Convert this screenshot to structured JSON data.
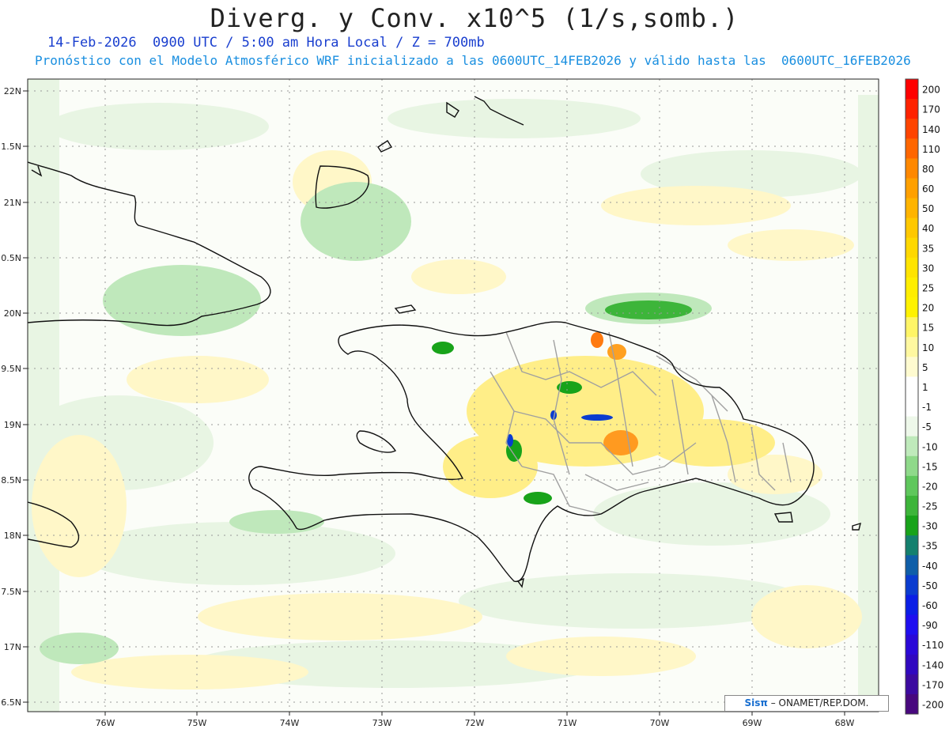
{
  "title": "Diverg. y Conv. x10^5 (1/s,somb.)",
  "subtitle_line1": "14-Feb-2026  0900 UTC / 5:00 am Hora Local / Z = 700mb",
  "subtitle_line2": "Pronóstico con el Modelo Atmosférico WRF inicializado a las 0600UTC_14FEB2026 y válido hasta las  0600UTC_16FEB2026",
  "lat_labels": [
    "22N",
    "1.5N",
    "21N",
    "0.5N",
    "20N",
    "9.5N",
    "19N",
    "8.5N",
    "18N",
    "7.5N",
    "17N",
    "6.5N"
  ],
  "lon_labels": [
    "76W",
    "75W",
    "74W",
    "73W",
    "72W",
    "71W",
    "70W",
    "69W",
    "68W"
  ],
  "colorbar": {
    "labels": [
      "200",
      "170",
      "140",
      "110",
      "80",
      "60",
      "50",
      "40",
      "35",
      "30",
      "25",
      "20",
      "15",
      "10",
      "5",
      "1",
      "-1",
      "-5",
      "-10",
      "-15",
      "-20",
      "-25",
      "-30",
      "-35",
      "-40",
      "-50",
      "-60",
      "-90",
      "-110",
      "-140",
      "-170",
      "-200"
    ],
    "colors": [
      "#ff0000",
      "#ff2200",
      "#ff4400",
      "#ff6600",
      "#ff8800",
      "#ffa000",
      "#ffb400",
      "#ffc800",
      "#ffd800",
      "#ffe400",
      "#ffee00",
      "#fff200",
      "#fff566",
      "#fff8a0",
      "#fffbd0",
      "#ffffff",
      "#ffffff",
      "#eef8ea",
      "#bfeabb",
      "#8fd98a",
      "#5fc75c",
      "#3db53a",
      "#18a31a",
      "#14806e",
      "#0f5ea8",
      "#0a3cd0",
      "#0a1ee6",
      "#1e0ef0",
      "#2a08d8",
      "#3008c0",
      "#3c0aa0",
      "#48087e"
    ]
  },
  "credit_brand": "Sisπ",
  "credit_text": " – ONAMET/REP.DOM."
}
